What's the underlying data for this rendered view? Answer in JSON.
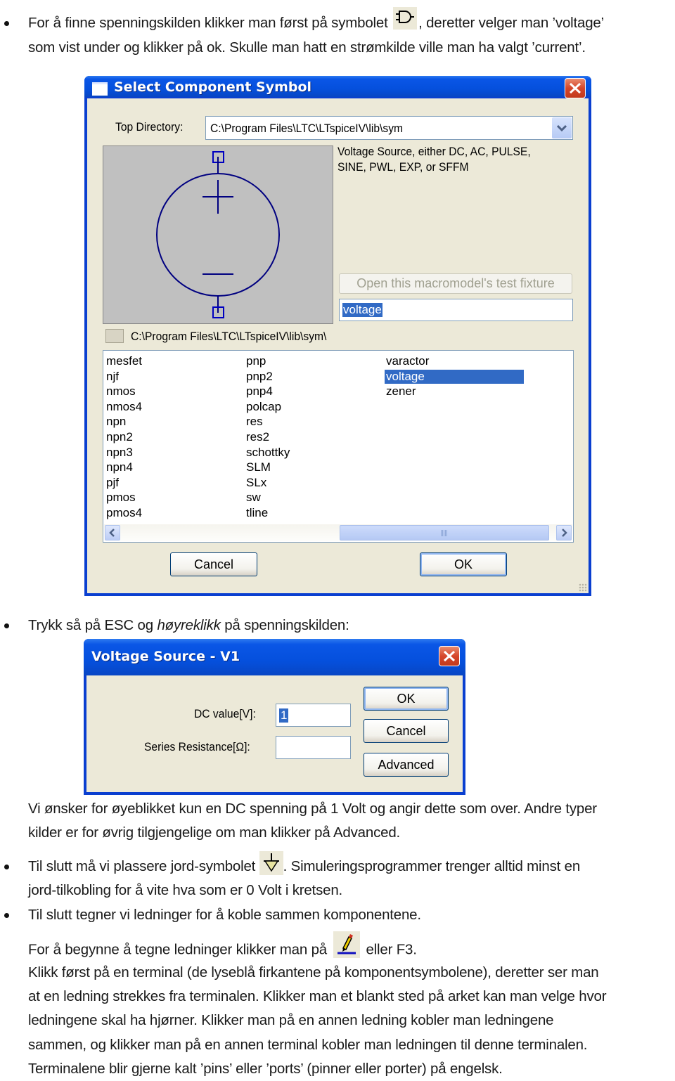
{
  "doc": {
    "para1": {
      "line1_before_icon": "For å finne spenningskilden klikker man først på symbolet",
      "line1_after_icon": ", deretter velger man ’voltage’",
      "line2": "som vist under og klikker på ok. Skulle man hatt en strømkilde ville man ha valgt ’current’.",
      "icon": "component-symbol-icon"
    },
    "para2": {
      "before_italic": "Trykk så på ESC og ",
      "italic": "høyreklikk",
      "after_italic": " på spenningskilden:"
    },
    "para3": {
      "line1": "Vi ønsker for øyeblikket kun en DC spenning på 1 Volt og angir dette som over. Andre typer",
      "line2": "kilder er for øvrig tilgjengelige om man klikker på Advanced."
    },
    "para4": {
      "line1_before_icon": "Til slutt må vi plassere jord-symbolet",
      "line1_after_icon": ". Simuleringsprogrammer trenger alltid minst en",
      "line2": "jord-tilkobling for å vite hva som er 0 Volt i kretsen.",
      "icon": "ground-icon"
    },
    "para5": {
      "line1": "Til slutt tegner vi ledninger for å koble sammen komponentene."
    },
    "para6": {
      "line1_before_icon": "For å begynne å tegne ledninger klikker man på",
      "line1_after_icon": "eller F3.",
      "icon": "wire-pencil-icon",
      "lines": [
        "Klikk først på en terminal (de lyseblå firkantene på komponentsymbolene), deretter ser man",
        "at en ledning strekkes fra terminalen. Klikker man et blankt sted på arket kan man velge hvor",
        "ledningene skal ha hjørner. Klikker man på en annen ledning kobler man ledningene",
        "sammen, og klikker man på en annen terminal kobler man ledningen til denne terminalen.",
        "Terminalene blir gjerne kalt ’pins’ eller ’ports’ (pinner eller porter) på engelsk."
      ]
    }
  },
  "select_dialog": {
    "title": "Select Component Symbol",
    "top_directory_label": "Top Directory:",
    "top_directory_value": "C:\\Program Files\\LTC\\LTspiceIV\\lib\\sym",
    "description_line1": "Voltage Source, either DC, AC, PULSE,",
    "description_line2": "SINE, PWL, EXP, or SFFM",
    "test_fixture_button": "Open this macromodel's test fixture",
    "search_value": "voltage",
    "current_path": "C:\\Program Files\\LTC\\LTspiceIV\\lib\\sym\\",
    "columns": [
      [
        "mesfet",
        "njf",
        "nmos",
        "nmos4",
        "npn",
        "npn2",
        "npn3",
        "npn4",
        "pjf",
        "pmos",
        "pmos4"
      ],
      [
        "pnp",
        "pnp2",
        "pnp4",
        "polcap",
        "res",
        "res2",
        "schottky",
        "SLM",
        "SLx",
        "sw",
        "tline"
      ],
      [
        "varactor",
        "voltage",
        "zener"
      ]
    ],
    "selected_item": "voltage",
    "cancel_label": "Cancel",
    "ok_label": "OK"
  },
  "voltage_dialog": {
    "title": "Voltage Source - V1",
    "dc_label": "DC value[V]:",
    "dc_value": "1",
    "series_label": "Series Resistance[Ω]:",
    "series_value": "",
    "ok_label": "OK",
    "cancel_label": "Cancel",
    "advanced_label": "Advanced"
  },
  "colors": {
    "title_bar": "#0550dd",
    "dialog_bg": "#ece9d8",
    "selection": "#316ac5",
    "symbol_stroke": "#0000a0",
    "preview_bg": "#c0c0c0"
  }
}
